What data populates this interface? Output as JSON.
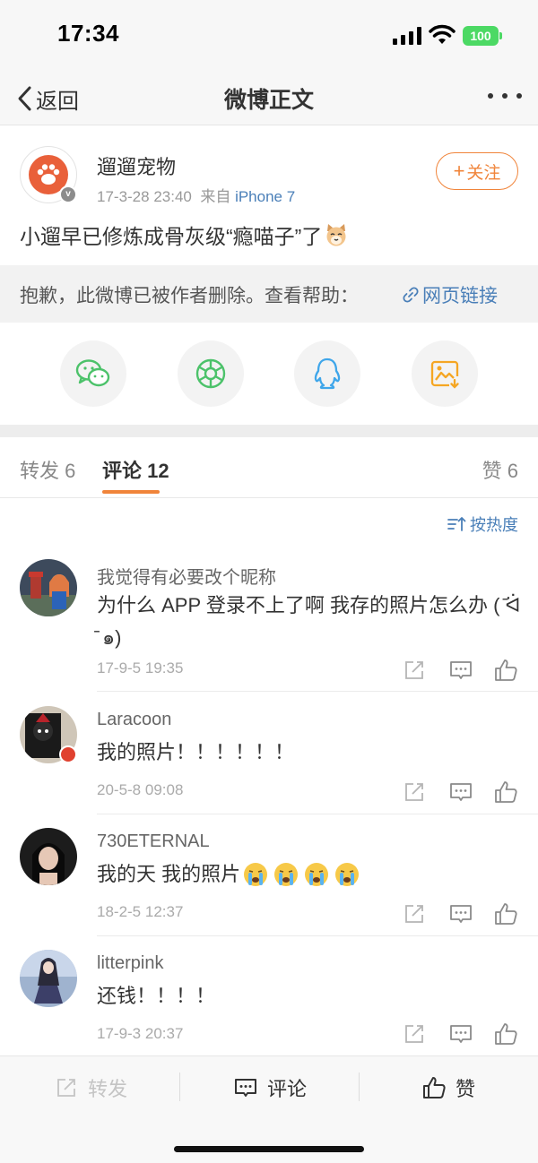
{
  "status_bar": {
    "time": "17:34",
    "battery": "100"
  },
  "nav": {
    "back_label": "返回",
    "title": "微博正文"
  },
  "post": {
    "author": "遛遛宠物",
    "timestamp": "17-3-28 23:40",
    "source_prefix": "来自",
    "device": "iPhone 7",
    "follow_label": "关注",
    "text": "小遛早已修炼成骨灰级“瘾喵子”了",
    "deleted_notice": "抱歉，此微博已被作者删除。查看帮助：",
    "help_link": "网页链接"
  },
  "share_targets": [
    "wechat-icon",
    "moments-icon",
    "qq-icon",
    "save-image-icon"
  ],
  "tabs": {
    "repost": "转发 6",
    "comments": "评论 12",
    "likes": "赞 6"
  },
  "sort_label": "按热度",
  "comments": [
    {
      "user": "我觉得有必要改个昵称",
      "text": "为什么 APP 登录不上了啊 我存的照片怎么办 (  ̄ᐛ ̄ ๑)",
      "time": "17-9-5 19:35"
    },
    {
      "user": "Laracoon",
      "text": "我的照片！！！！！！",
      "time": "20-5-8 09:08"
    },
    {
      "user": "730ETERNAL",
      "text": "我的天  我的照片",
      "time": "18-2-5 12:37"
    },
    {
      "user": "litterpink",
      "text": "还钱！！！！",
      "time": "17-9-3 20:37"
    }
  ],
  "bottom_bar": {
    "repost": "转发",
    "comment": "评论",
    "like": "赞"
  },
  "colors": {
    "accent": "#f0843a",
    "link": "#4a7fb8",
    "background": "#ffffff"
  }
}
